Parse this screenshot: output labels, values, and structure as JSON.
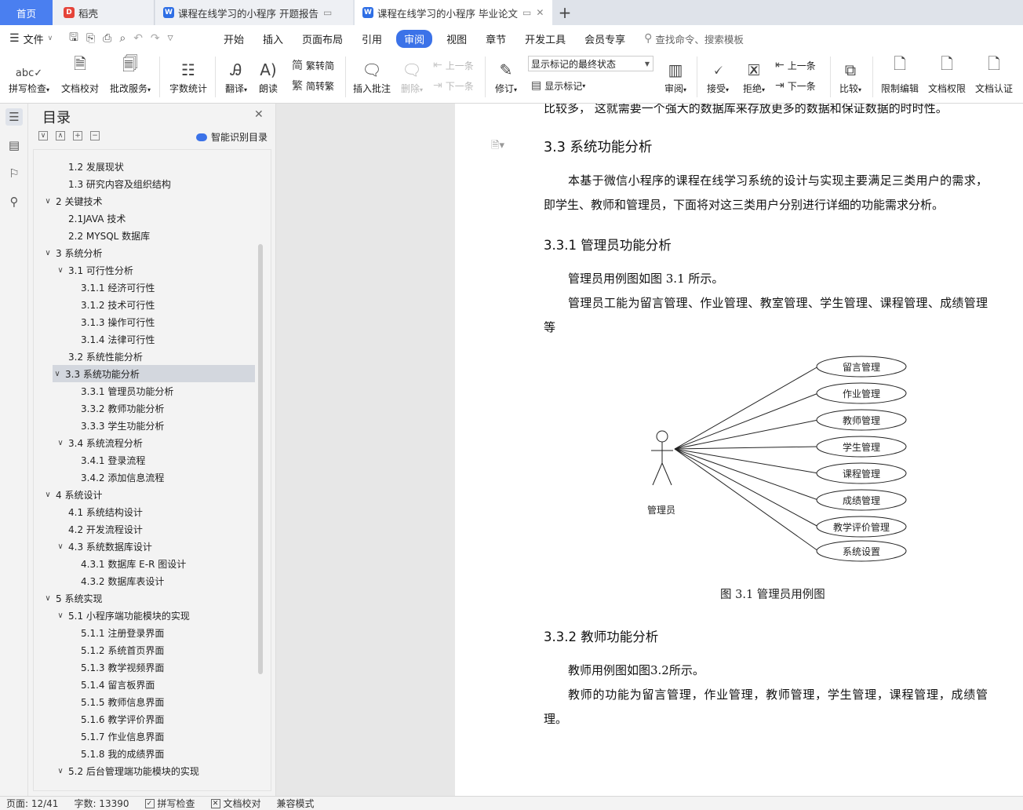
{
  "tabs": {
    "home": "首页",
    "daoke": "稻壳",
    "doc1": "课程在线学习的小程序 开题报告",
    "doc2": "课程在线学习的小程序 毕业论文"
  },
  "menubar": {
    "file": "文件",
    "items": [
      "开始",
      "插入",
      "页面布局",
      "引用",
      "审阅",
      "视图",
      "章节",
      "开发工具",
      "会员专享"
    ],
    "active_index": 4,
    "search_placeholder": "查找命令、搜索模板"
  },
  "ribbon": {
    "spell_check": "拼写检查",
    "doc_proof": "文档校对",
    "review_service": "批改服务",
    "word_count": "字数统计",
    "translate": "翻译",
    "read_aloud": "朗读",
    "to_traditional": "繁转简",
    "to_simplified": "简转繁",
    "insert_comment": "插入批注",
    "delete": "删除",
    "prev": "上一条",
    "next": "下一条",
    "revise": "修订",
    "markup_state": "显示标记的最终状态",
    "show_markup": "显示标记",
    "review": "审阅",
    "accept": "接受",
    "reject": "拒绝",
    "prev2": "上一条",
    "next2": "下一条",
    "compare": "比较",
    "restrict_edit": "限制编辑",
    "doc_permission": "文档权限",
    "doc_auth": "文档认证"
  },
  "toc": {
    "title": "目录",
    "smart": "智能识别目录",
    "items": [
      {
        "text": "1.2 发展现状",
        "level": 2,
        "caret": ""
      },
      {
        "text": "1.3 研究内容及组织结构",
        "level": 2,
        "caret": ""
      },
      {
        "text": "2  关键技术",
        "level": 1,
        "caret": "v"
      },
      {
        "text": "2.1JAVA 技术",
        "level": 2,
        "caret": ""
      },
      {
        "text": "2.2 MYSQL 数据库",
        "level": 2,
        "caret": ""
      },
      {
        "text": "3  系统分析",
        "level": 1,
        "caret": "v"
      },
      {
        "text": "3.1 可行性分析",
        "level": 2,
        "caret": "v"
      },
      {
        "text": "3.1.1 经济可行性",
        "level": 3,
        "caret": ""
      },
      {
        "text": "3.1.2 技术可行性",
        "level": 3,
        "caret": ""
      },
      {
        "text": "3.1.3  操作可行性",
        "level": 3,
        "caret": ""
      },
      {
        "text": "3.1.4 法律可行性",
        "level": 3,
        "caret": ""
      },
      {
        "text": "3.2 系统性能分析",
        "level": 2,
        "caret": ""
      },
      {
        "text": "3.3 系统功能分析",
        "level": 2,
        "caret": "v",
        "selected": true
      },
      {
        "text": "3.3.1 管理员功能分析",
        "level": 3,
        "caret": ""
      },
      {
        "text": "3.3.2 教师功能分析",
        "level": 3,
        "caret": ""
      },
      {
        "text": "3.3.3 学生功能分析",
        "level": 3,
        "caret": ""
      },
      {
        "text": "3.4 系统流程分析",
        "level": 2,
        "caret": "v"
      },
      {
        "text": "3.4.1 登录流程",
        "level": 3,
        "caret": ""
      },
      {
        "text": "3.4.2 添加信息流程",
        "level": 3,
        "caret": ""
      },
      {
        "text": "4  系统设计",
        "level": 1,
        "caret": "v"
      },
      {
        "text": "4.1 系统结构设计",
        "level": 2,
        "caret": ""
      },
      {
        "text": "4.2 开发流程设计",
        "level": 2,
        "caret": ""
      },
      {
        "text": "4.3 系统数据库设计",
        "level": 2,
        "caret": "v"
      },
      {
        "text": "4.3.1  数据库 E-R 图设计",
        "level": 3,
        "caret": ""
      },
      {
        "text": "4.3.2  数据库表设计",
        "level": 3,
        "caret": ""
      },
      {
        "text": "5  系统实现",
        "level": 1,
        "caret": "v"
      },
      {
        "text": "5.1 小程序端功能模块的实现",
        "level": 2,
        "caret": "v"
      },
      {
        "text": "5.1.1 注册登录界面",
        "level": 3,
        "caret": ""
      },
      {
        "text": "5.1.2 系统首页界面",
        "level": 3,
        "caret": ""
      },
      {
        "text": "5.1.3 教学视频界面",
        "level": 3,
        "caret": ""
      },
      {
        "text": "5.1.4 留言板界面",
        "level": 3,
        "caret": ""
      },
      {
        "text": "5.1.5 教师信息界面",
        "level": 3,
        "caret": ""
      },
      {
        "text": "5.1.6 教学评价界面",
        "level": 3,
        "caret": ""
      },
      {
        "text": "5.1.7 作业信息界面",
        "level": 3,
        "caret": ""
      },
      {
        "text": "5.1.8 我的成绩界面",
        "level": 3,
        "caret": ""
      },
      {
        "text": "5.2 后台管理端功能模块的实现",
        "level": 2,
        "caret": "v"
      }
    ]
  },
  "document": {
    "line0": "比较多，  这就需要一个强大的数据库来存放更多的数据和保证数据的时时性。",
    "h_33": "3.3 系统功能分析",
    "para_33": "本基于微信小程序的课程在线学习系统的设计与实现主要满足三类用户的需求，即学生、教师和管理员，下面将对这三类用户分别进行详细的功能需求分析。",
    "h_331": "3.3.1 管理员功能分析",
    "para_331a": "管理员用例图如图 3.1 所示。",
    "para_331b": "管理员工能为留言管理、作业管理、教室管理、学生管理、课程管理、成绩管理等",
    "actor": "管理员",
    "usecases": [
      "留言管理",
      "作业管理",
      "教师管理",
      "学生管理",
      "课程管理",
      "成绩管理",
      "教学评价管理",
      "系统设置"
    ],
    "fig_caption": "图  3.1  管理员用例图",
    "h_332": "3.3.2 教师功能分析",
    "para_332a": "教师用例图如图3.2所示。",
    "para_332b": "教师的功能为留言管理，作业管理，教师管理，学生管理，课程管理，成绩管理。"
  },
  "status": {
    "page": "页面: 12/41",
    "words": "字数: 13390",
    "spell": "拼写检查",
    "proof": "文档校对",
    "compat": "兼容模式"
  }
}
